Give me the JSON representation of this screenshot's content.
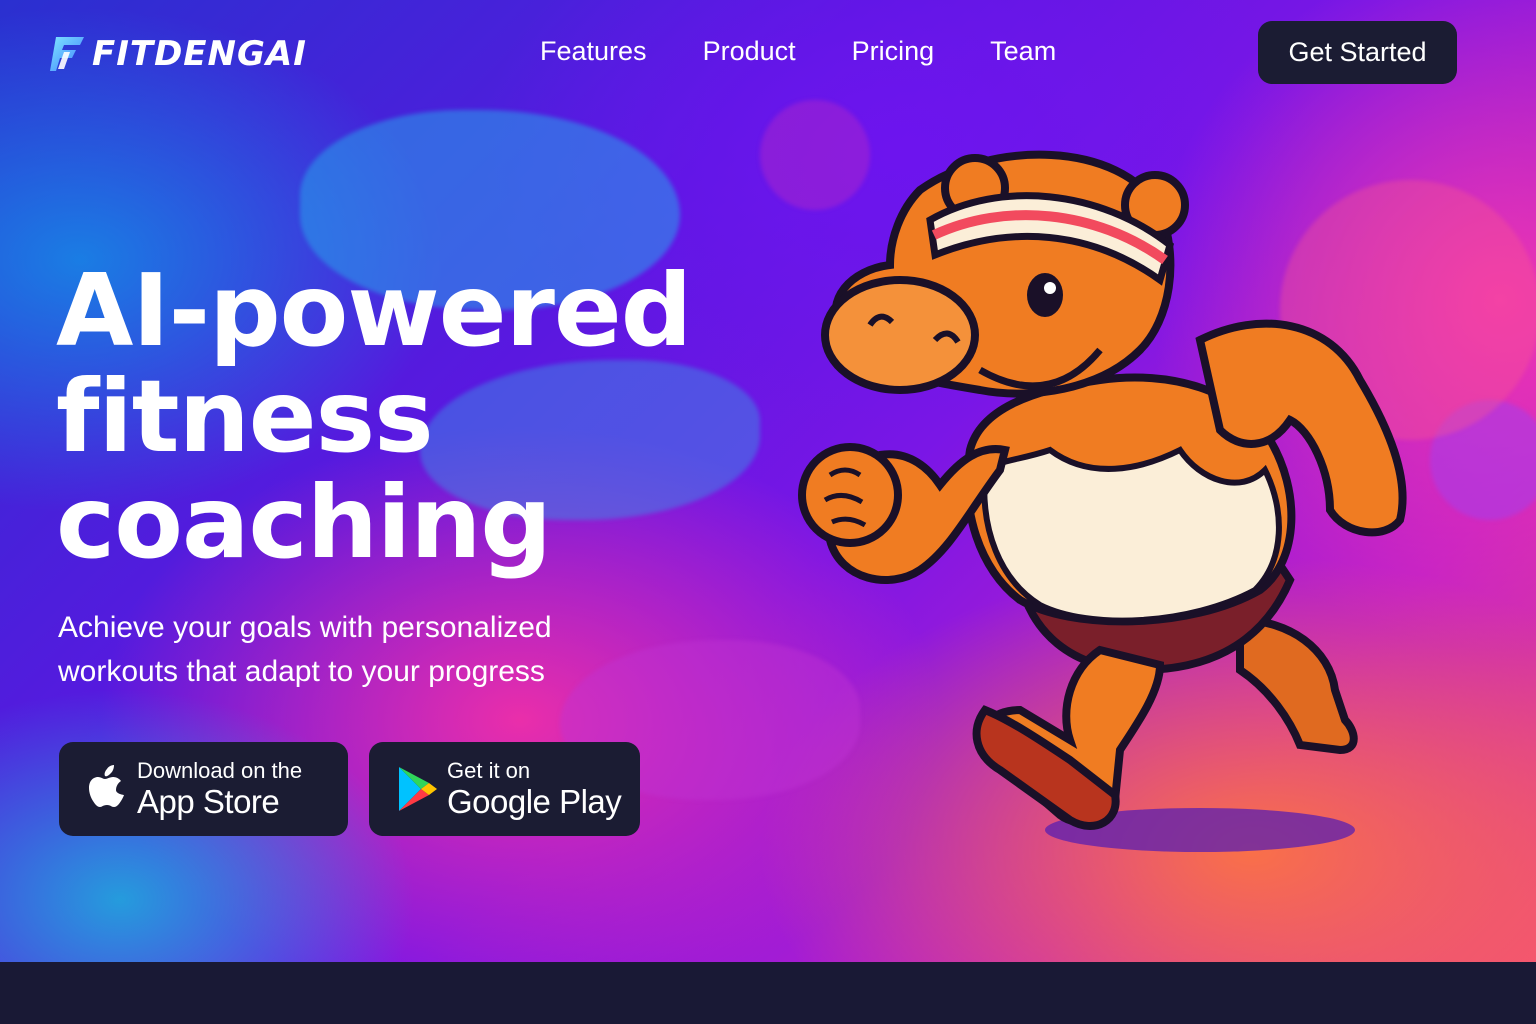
{
  "brand": {
    "name": "FITDENGAI"
  },
  "nav": {
    "items": [
      {
        "label": "Features"
      },
      {
        "label": "Product"
      },
      {
        "label": "Pricing"
      },
      {
        "label": "Team"
      }
    ]
  },
  "header": {
    "cta_label": "Get Started"
  },
  "hero": {
    "headline_lines": [
      "AI-powered",
      "fitness",
      "coaching"
    ],
    "subtitle_lines": [
      "Achieve your goals with personalized",
      "workouts that adapt to your progress"
    ]
  },
  "stores": {
    "apple": {
      "small": "Download on the",
      "big": "App Store",
      "icon": "apple-icon"
    },
    "google": {
      "small": "Get it on",
      "big": "Google Play",
      "icon": "google-play-icon"
    }
  },
  "mascot": {
    "icon": "hippo-runner-illustration"
  },
  "colors": {
    "button_bg": "#1b1c33",
    "text": "#ffffff",
    "footer_band": "#191935"
  }
}
